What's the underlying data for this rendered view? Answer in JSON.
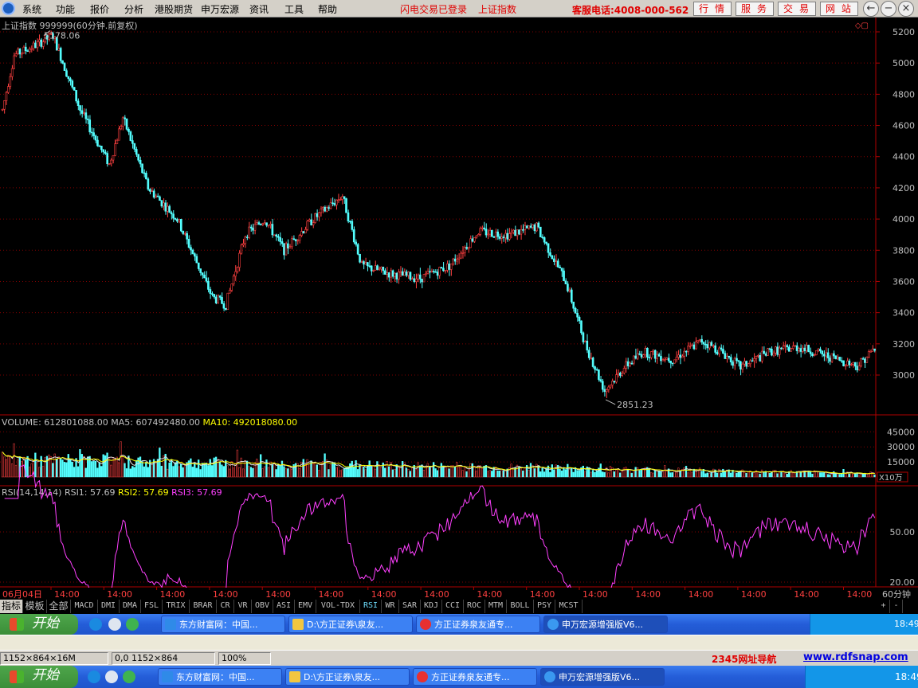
{
  "menubar": {
    "items": [
      "系统",
      "功能",
      "报价",
      "分析",
      "港股期货",
      "申万宏源",
      "资讯",
      "工具",
      "帮助"
    ],
    "status_left": "闪电交易已登录",
    "status_right": "上证指数",
    "hotline": "客服电话:4008-000-562",
    "buttons": [
      "行情",
      "服务",
      "交易",
      "网站"
    ],
    "window_controls": [
      "←",
      "−",
      "▭",
      "×"
    ]
  },
  "chart_data": [
    {
      "type": "candlestick",
      "title": "上证指数 999999(60分钟.前复权)",
      "ylim": [
        2750,
        5250
      ],
      "y_ticks": [
        3000,
        3200,
        3400,
        3600,
        3800,
        4000,
        4200,
        4400,
        4600,
        4800,
        5000,
        5200
      ],
      "up_color": "#ff4040",
      "down_color": "#54ffff",
      "grid": "dotted horizontal red lines",
      "annotations": [
        {
          "label": "5178.06",
          "kind": "high"
        },
        {
          "label": "2851.23",
          "kind": "low"
        }
      ],
      "trend_keypoints": [
        {
          "t": 0,
          "v": 4700
        },
        {
          "t": 6,
          "v": 5050
        },
        {
          "t": 18,
          "v": 5120
        },
        {
          "t": 26,
          "v": 5178
        },
        {
          "t": 40,
          "v": 4700
        },
        {
          "t": 55,
          "v": 4350
        },
        {
          "t": 62,
          "v": 4650
        },
        {
          "t": 75,
          "v": 4200
        },
        {
          "t": 90,
          "v": 4000
        },
        {
          "t": 108,
          "v": 3500
        },
        {
          "t": 115,
          "v": 3450
        },
        {
          "t": 125,
          "v": 3900
        },
        {
          "t": 135,
          "v": 4000
        },
        {
          "t": 145,
          "v": 3800
        },
        {
          "t": 160,
          "v": 4000
        },
        {
          "t": 175,
          "v": 4150
        },
        {
          "t": 185,
          "v": 3700
        },
        {
          "t": 200,
          "v": 3650
        },
        {
          "t": 215,
          "v": 3620
        },
        {
          "t": 230,
          "v": 3700
        },
        {
          "t": 245,
          "v": 3920
        },
        {
          "t": 260,
          "v": 3900
        },
        {
          "t": 275,
          "v": 3950
        },
        {
          "t": 290,
          "v": 3600
        },
        {
          "t": 300,
          "v": 3200
        },
        {
          "t": 310,
          "v": 2900
        },
        {
          "t": 320,
          "v": 3050
        },
        {
          "t": 330,
          "v": 3150
        },
        {
          "t": 345,
          "v": 3100
        },
        {
          "t": 360,
          "v": 3220
        },
        {
          "t": 370,
          "v": 3150
        },
        {
          "t": 380,
          "v": 3050
        },
        {
          "t": 395,
          "v": 3150
        },
        {
          "t": 410,
          "v": 3180
        },
        {
          "t": 425,
          "v": 3120
        },
        {
          "t": 440,
          "v": 3060
        },
        {
          "t": 449,
          "v": 3170
        }
      ]
    },
    {
      "type": "bar",
      "title": "VOLUME: 612801088.00",
      "series_labels": [
        {
          "name": "VOLUME",
          "value": "612801088.00"
        },
        {
          "name": "MA5",
          "value": "607492480.00"
        },
        {
          "name": "MA10",
          "value": "492018080.00"
        }
      ],
      "y_ticks": [
        15000,
        30000,
        45000
      ],
      "unit": "X10万"
    },
    {
      "type": "line",
      "title": "RSI(14,14,14)",
      "series_labels": [
        {
          "name": "RSI1",
          "value": "57.69"
        },
        {
          "name": "RSI2",
          "value": "57.69"
        },
        {
          "name": "RSI3",
          "value": "57.69"
        }
      ],
      "y_ticks": [
        20.0,
        50.0
      ],
      "ylim": [
        15,
        90
      ],
      "line_color": "#ff40ff"
    }
  ],
  "x_axis": {
    "first": "06月04日",
    "labels": [
      "14:00",
      "14:00",
      "14:00",
      "14:00",
      "14:00",
      "14:00",
      "14:00",
      "14:00",
      "14:00",
      "14:00",
      "14:00",
      "14:00",
      "14:00",
      "14:00",
      "14:00",
      "14:00"
    ],
    "period": "60分钟"
  },
  "tabs": [
    "指标",
    "模板",
    "全部",
    "MACD",
    "DMI",
    "DMA",
    "FSL",
    "TRIX",
    "BRAR",
    "CR",
    "VR",
    "OBV",
    "ASI",
    "EMV",
    "VOL-TDX",
    "RSI",
    "WR",
    "SAR",
    "KDJ",
    "CCI",
    "ROC",
    "MTM",
    "BOLL",
    "PSY",
    "MCST"
  ],
  "tab_active": "RSI",
  "tab_controls": [
    "+",
    "-"
  ],
  "taskbar": {
    "start": "开始",
    "items": [
      "东方财富网：中国...",
      "D:\\方正证券\\泉友...",
      "方正证券泉友通专...",
      "申万宏源增强版V6..."
    ],
    "time": "18:49"
  },
  "statusbar": {
    "size": "1152×864×16M",
    "coords": "0,0 1152×864",
    "zoom": "100%",
    "nav": "2345网址导航",
    "site": "www.rdfsnap.com"
  }
}
